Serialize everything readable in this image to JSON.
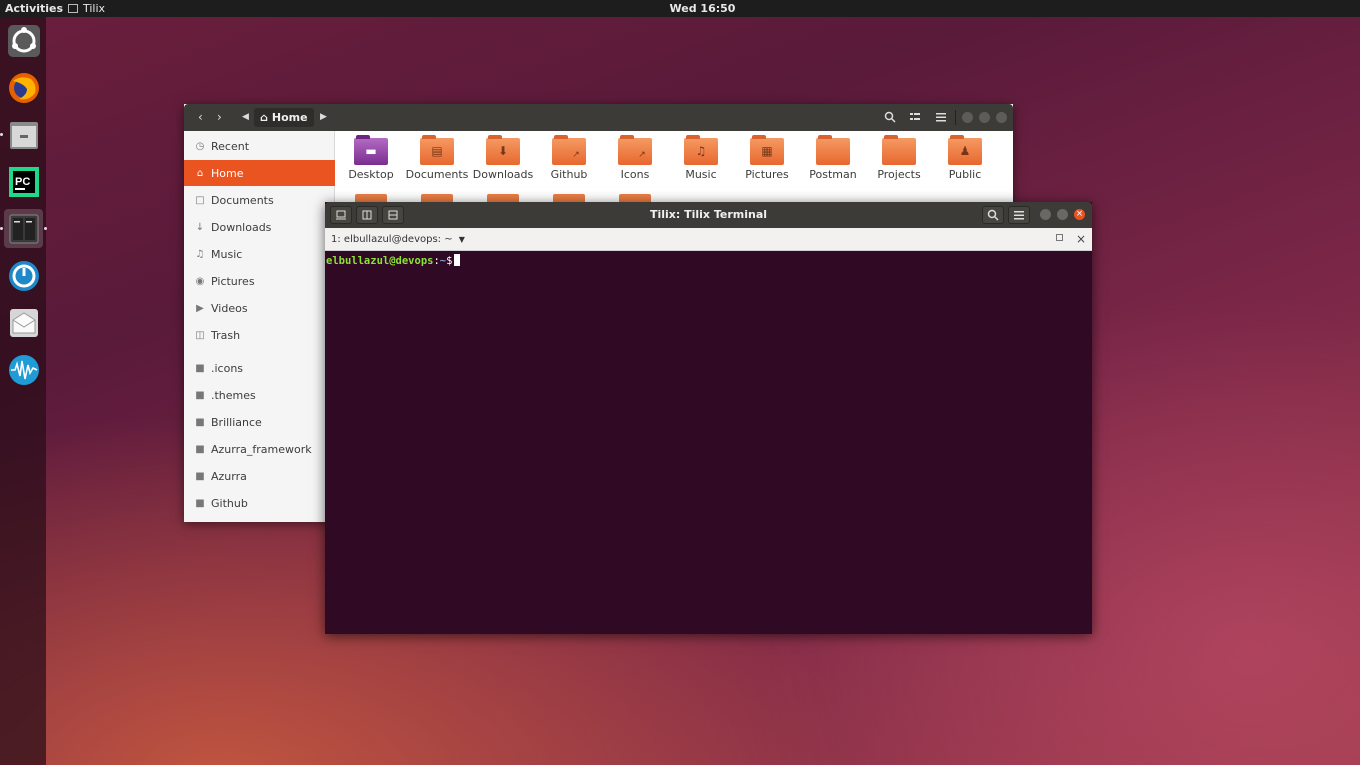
{
  "topbar": {
    "activities": "Activities",
    "app_name": "Tilix",
    "clock": "Wed 16:50"
  },
  "dock": {
    "items": [
      {
        "name": "ubuntu-software-icon"
      },
      {
        "name": "firefox-icon"
      },
      {
        "name": "files-icon"
      },
      {
        "name": "pycharm-icon",
        "label": "PC"
      },
      {
        "name": "tilix-icon"
      },
      {
        "name": "timeshift-icon"
      },
      {
        "name": "mail-icon"
      },
      {
        "name": "audio-recorder-icon"
      }
    ]
  },
  "files": {
    "path": "Home",
    "sidebar": [
      {
        "label": "Recent",
        "icon": "clock-icon"
      },
      {
        "label": "Home",
        "icon": "home-icon"
      },
      {
        "label": "Documents",
        "icon": "document-icon"
      },
      {
        "label": "Downloads",
        "icon": "download-icon"
      },
      {
        "label": "Music",
        "icon": "music-icon"
      },
      {
        "label": "Pictures",
        "icon": "camera-icon"
      },
      {
        "label": "Videos",
        "icon": "video-icon"
      },
      {
        "label": "Trash",
        "icon": "trash-icon"
      },
      {
        "label": ".icons",
        "icon": "folder-icon"
      },
      {
        "label": ".themes",
        "icon": "folder-icon"
      },
      {
        "label": "Brilliance",
        "icon": "folder-icon"
      },
      {
        "label": "Azurra_framework",
        "icon": "folder-icon"
      },
      {
        "label": "Azurra",
        "icon": "folder-icon"
      },
      {
        "label": "Github",
        "icon": "folder-icon"
      }
    ],
    "folders": [
      {
        "label": "Desktop"
      },
      {
        "label": "Documents"
      },
      {
        "label": "Downloads"
      },
      {
        "label": "Github"
      },
      {
        "label": "Icons"
      },
      {
        "label": "Music"
      },
      {
        "label": "Pictures"
      },
      {
        "label": "Postman"
      },
      {
        "label": "Projects"
      },
      {
        "label": "Public"
      }
    ]
  },
  "terminal": {
    "title": "Tilix: Tilix Terminal",
    "session": "1: elbullazul@devops: ~",
    "prompt_user": "elbullazul@devops",
    "prompt_sep": ":",
    "prompt_path": "~",
    "prompt_symbol": "$"
  },
  "colors": {
    "accent": "#e95420",
    "terminal_bg": "#300a24",
    "prompt_green": "#8ae234",
    "prompt_blue": "#729fcf"
  }
}
